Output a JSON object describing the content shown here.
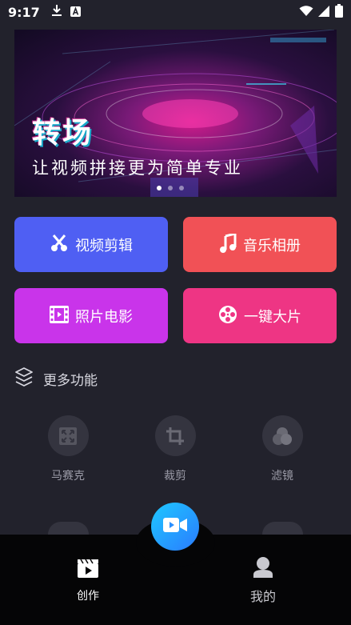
{
  "status_bar": {
    "time": "9:17"
  },
  "banner": {
    "title": "转场",
    "subtitle": "让视频拼接更为简单专业"
  },
  "main_actions": [
    {
      "label": "视频剪辑",
      "icon": "scissors-icon",
      "color": "#4f5ff3"
    },
    {
      "label": "音乐相册",
      "icon": "music-note-icon",
      "color": "#f15156"
    },
    {
      "label": "照片电影",
      "icon": "film-strip-icon",
      "color": "#c934ea"
    },
    {
      "label": "一键大片",
      "icon": "film-reel-icon",
      "color": "#ee3584"
    }
  ],
  "more": {
    "header": "更多功能",
    "tools": [
      {
        "label": "马赛克",
        "icon": "mosaic-icon"
      },
      {
        "label": "裁剪",
        "icon": "crop-icon"
      },
      {
        "label": "滤镜",
        "icon": "filter-icon"
      }
    ]
  },
  "bottom_nav": {
    "items": [
      {
        "label": "创作",
        "icon": "clapperboard-icon",
        "active": true
      },
      {
        "label": "我的",
        "icon": "person-icon",
        "active": false
      }
    ],
    "fab_icon": "video-camera-icon"
  }
}
